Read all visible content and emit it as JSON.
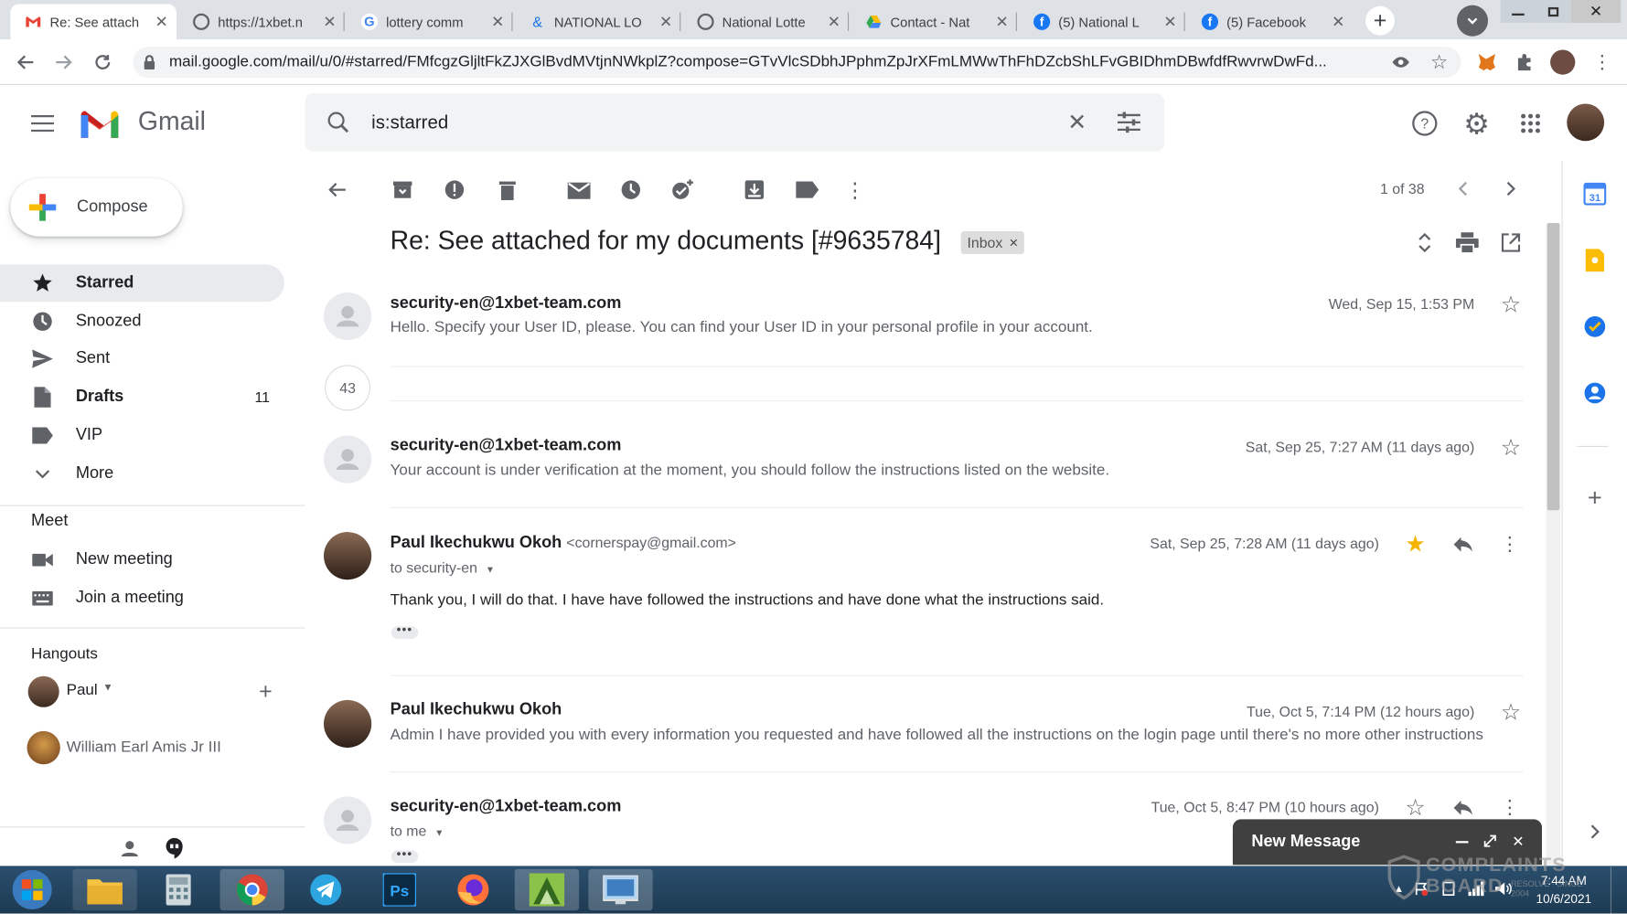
{
  "browser": {
    "tabs": [
      {
        "title": "Re: See attach",
        "active": true,
        "icon": "gmail-icon"
      },
      {
        "title": "https://1xbet.n",
        "icon": "globe-icon"
      },
      {
        "title": "lottery comm",
        "icon": "google-icon"
      },
      {
        "title": "NATIONAL LO",
        "icon": "link-icon"
      },
      {
        "title": "National Lotte",
        "icon": "globe-icon"
      },
      {
        "title": "Contact - Nat",
        "icon": "drive-icon"
      },
      {
        "title": "(5) National L",
        "icon": "facebook-icon"
      },
      {
        "title": "(5) Facebook",
        "icon": "facebook-icon"
      }
    ],
    "url": "mail.google.com/mail/u/0/#starred/FMfcgzGljltFkZJXGlBvdMVtjnNWkplZ?compose=GTvVlcSDbhJPphmZpJrXFmLMWwThFhDZcbShLFvGBIDhmDBwfdfRwvrwDwFd..."
  },
  "gmail": {
    "logo_text": "Gmail",
    "search_value": "is:starred",
    "compose_label": "Compose",
    "nav": [
      {
        "label": "Starred",
        "icon": "star-icon",
        "active": true
      },
      {
        "label": "Snoozed",
        "icon": "clock-icon"
      },
      {
        "label": "Sent",
        "icon": "send-icon"
      },
      {
        "label": "Drafts",
        "icon": "draft-icon",
        "count": "11"
      },
      {
        "label": "VIP",
        "icon": "label-icon"
      },
      {
        "label": "More",
        "icon": "chevron-down-icon"
      }
    ],
    "meet": {
      "heading": "Meet",
      "items": [
        "New meeting",
        "Join a meeting"
      ]
    },
    "hangouts": {
      "heading": "Hangouts",
      "current_user": "Paul",
      "contacts": [
        "William Earl Amis Jr III"
      ]
    },
    "pager": "1 of 38",
    "thread": {
      "subject": "Re: See attached for my documents [#9635784]",
      "label": "Inbox",
      "collapsed_count": "43",
      "messages": [
        {
          "sender": "security-en@1xbet-team.com",
          "email": "",
          "date": "Wed, Sep 15, 1:53 PM",
          "snippet": "Hello. Specify your User ID, please. You can find your User ID in your personal profile in your account.",
          "starred": false
        },
        {
          "sender": "security-en@1xbet-team.com",
          "email": "",
          "date": "Sat, Sep 25, 7:27 AM (11 days ago)",
          "snippet": "Your account is under verification at the moment, you should follow the instructions listed on the website.",
          "starred": false
        },
        {
          "sender": "Paul Ikechukwu Okoh",
          "email": "<cornerspay@gmail.com>",
          "to": "to security-en",
          "date": "Sat, Sep 25, 7:28 AM (11 days ago)",
          "body": "Thank you, I will do that. I have have followed the instructions and have done what the instructions said.",
          "starred": true
        },
        {
          "sender": "Paul Ikechukwu Okoh",
          "email": "",
          "date": "Tue, Oct 5, 7:14 PM (12 hours ago)",
          "snippet": "Admin I have provided you with every information you requested and have followed all the instructions on the login page until there's no more other instructions",
          "starred": false
        },
        {
          "sender": "security-en@1xbet-team.com",
          "email": "",
          "to": "to me",
          "date": "Tue, Oct 5, 8:47 PM (10 hours ago)",
          "starred": false
        }
      ]
    },
    "new_message_title": "New Message"
  },
  "taskbar": {
    "clock_time": "7:44 AM",
    "clock_date": "10/6/2021"
  },
  "watermark": {
    "line1": "COMPLAINTS",
    "line2": "BOARD",
    "line3": "RESOLVE · SINCE 2004"
  },
  "colors": {
    "gmail_red": "#ea4335",
    "gmail_blue": "#4285f4",
    "gmail_yellow": "#fbbc04",
    "gmail_green": "#34a853",
    "star_yellow": "#f4b400",
    "taskbar": "#1f3d57"
  }
}
